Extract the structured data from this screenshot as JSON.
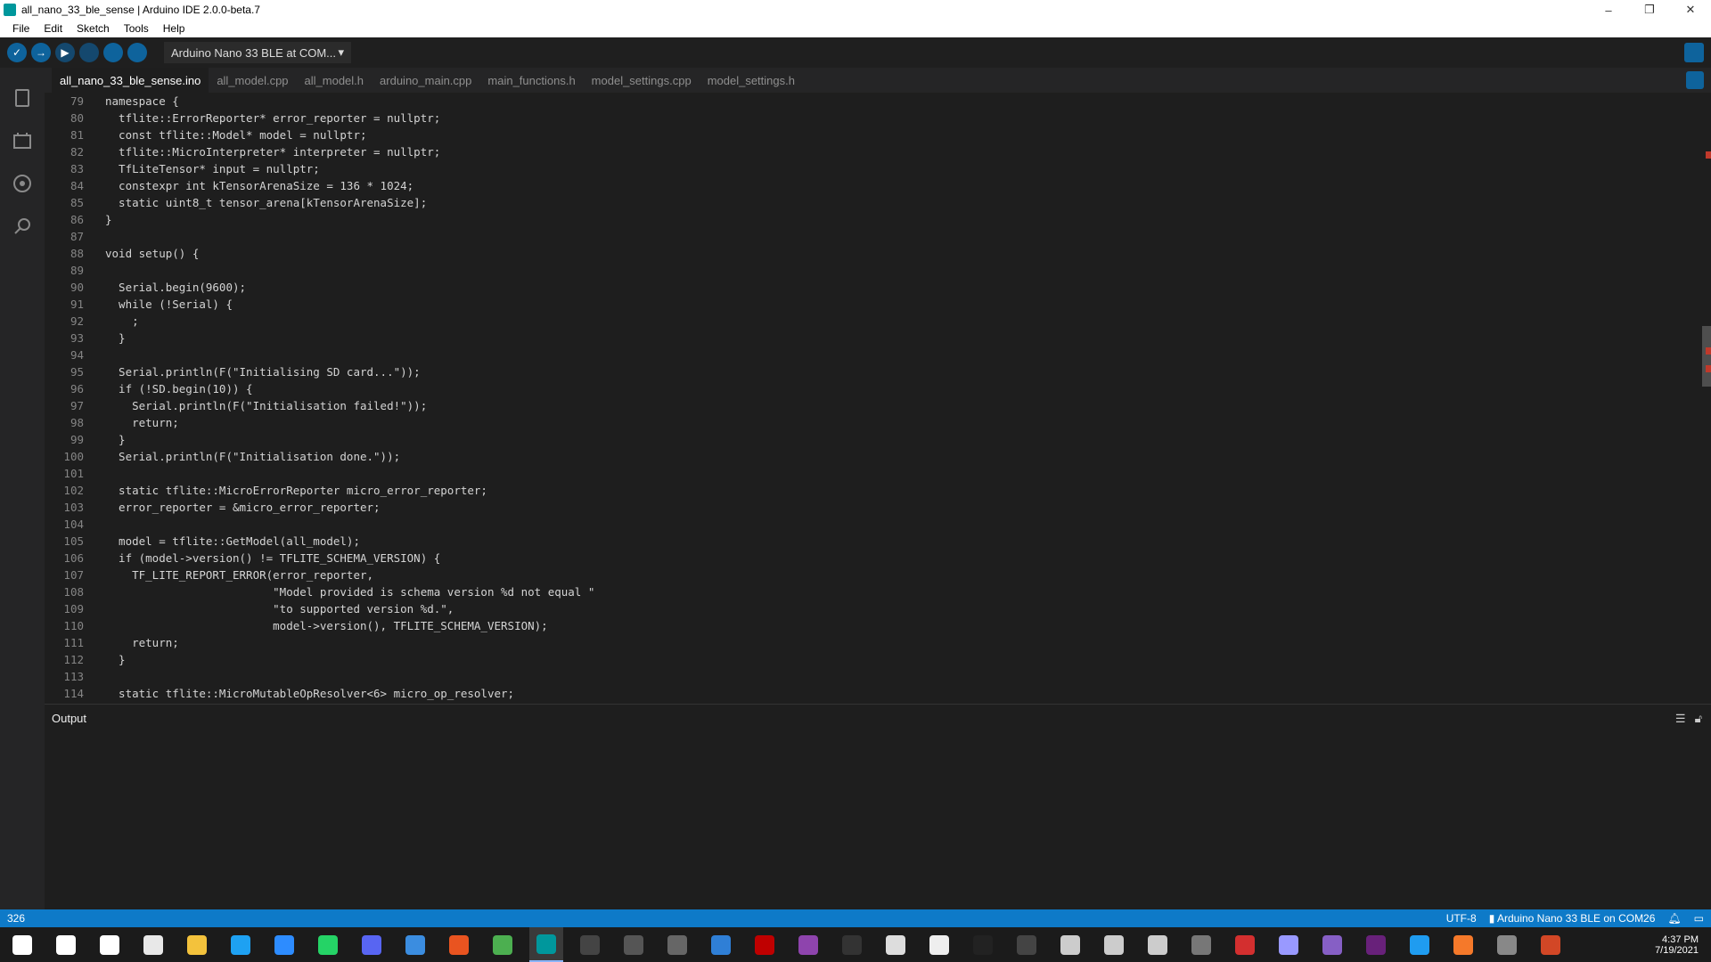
{
  "window": {
    "title": "all_nano_33_ble_sense | Arduino IDE 2.0.0-beta.7",
    "minimize": "–",
    "restore": "❐",
    "close": "✕"
  },
  "menu": [
    "File",
    "Edit",
    "Sketch",
    "Tools",
    "Help"
  ],
  "toolbar": {
    "verify": "✓",
    "upload": "→",
    "debug": "▶",
    "board": "Arduino Nano 33 BLE at COM...",
    "board_caret": "▾"
  },
  "tabs": [
    {
      "label": "all_nano_33_ble_sense.ino",
      "active": true
    },
    {
      "label": "all_model.cpp"
    },
    {
      "label": "all_model.h"
    },
    {
      "label": "arduino_main.cpp"
    },
    {
      "label": "main_functions.h"
    },
    {
      "label": "model_settings.cpp"
    },
    {
      "label": "model_settings.h"
    }
  ],
  "code_lines": [
    {
      "n": "79",
      "t": "namespace {"
    },
    {
      "n": "80",
      "t": "  tflite::ErrorReporter* error_reporter = nullptr;"
    },
    {
      "n": "81",
      "t": "  const tflite::Model* model = nullptr;"
    },
    {
      "n": "82",
      "t": "  tflite::MicroInterpreter* interpreter = nullptr;"
    },
    {
      "n": "83",
      "t": "  TfLiteTensor* input = nullptr;"
    },
    {
      "n": "84",
      "t": "  constexpr int kTensorArenaSize = 136 * 1024;"
    },
    {
      "n": "85",
      "t": "  static uint8_t tensor_arena[kTensorArenaSize];"
    },
    {
      "n": "86",
      "t": "}"
    },
    {
      "n": "87",
      "t": ""
    },
    {
      "n": "88",
      "t": "void setup() {"
    },
    {
      "n": "89",
      "t": ""
    },
    {
      "n": "90",
      "t": "  Serial.begin(9600);"
    },
    {
      "n": "91",
      "t": "  while (!Serial) {"
    },
    {
      "n": "92",
      "t": "    ;"
    },
    {
      "n": "93",
      "t": "  }"
    },
    {
      "n": "94",
      "t": ""
    },
    {
      "n": "95",
      "t": "  Serial.println(F(\"Initialising SD card...\"));"
    },
    {
      "n": "96",
      "t": "  if (!SD.begin(10)) {"
    },
    {
      "n": "97",
      "t": "    Serial.println(F(\"Initialisation failed!\"));"
    },
    {
      "n": "98",
      "t": "    return;"
    },
    {
      "n": "99",
      "t": "  }"
    },
    {
      "n": "100",
      "t": "  Serial.println(F(\"Initialisation done.\"));"
    },
    {
      "n": "101",
      "t": ""
    },
    {
      "n": "102",
      "t": "  static tflite::MicroErrorReporter micro_error_reporter;"
    },
    {
      "n": "103",
      "t": "  error_reporter = &micro_error_reporter;"
    },
    {
      "n": "104",
      "t": ""
    },
    {
      "n": "105",
      "t": "  model = tflite::GetModel(all_model);"
    },
    {
      "n": "106",
      "t": "  if (model->version() != TFLITE_SCHEMA_VERSION) {"
    },
    {
      "n": "107",
      "t": "    TF_LITE_REPORT_ERROR(error_reporter,"
    },
    {
      "n": "108",
      "t": "                         \"Model provided is schema version %d not equal \""
    },
    {
      "n": "109",
      "t": "                         \"to supported version %d.\","
    },
    {
      "n": "110",
      "t": "                         model->version(), TFLITE_SCHEMA_VERSION);"
    },
    {
      "n": "111",
      "t": "    return;"
    },
    {
      "n": "112",
      "t": "  }"
    },
    {
      "n": "113",
      "t": ""
    },
    {
      "n": "114",
      "t": "  static tflite::MicroMutableOpResolver<6> micro_op_resolver;"
    }
  ],
  "output": {
    "title": "Output"
  },
  "statusbar": {
    "line": "326",
    "encoding": "UTF-8",
    "board": "Arduino Nano 33 BLE on COM26"
  },
  "taskbar": {
    "time": "4:37 PM",
    "date": "7/19/2021",
    "icons": [
      {
        "name": "windows-start-icon",
        "color": "#ffffff"
      },
      {
        "name": "search-icon",
        "color": "#ffffff"
      },
      {
        "name": "task-view-icon",
        "color": "#ffffff"
      },
      {
        "name": "app-icon-1",
        "color": "#e8e8e8"
      },
      {
        "name": "file-explorer-icon",
        "color": "#f3c23c"
      },
      {
        "name": "skype-icon",
        "color": "#1ea1f2"
      },
      {
        "name": "zoom-icon",
        "color": "#2d8cff"
      },
      {
        "name": "whatsapp-icon",
        "color": "#25d366"
      },
      {
        "name": "discord-icon",
        "color": "#5865f2"
      },
      {
        "name": "app-icon-2",
        "color": "#3b8de0"
      },
      {
        "name": "app-icon-3",
        "color": "#e95420"
      },
      {
        "name": "chrome-icon",
        "color": "#4caf50"
      },
      {
        "name": "arduino-ide-icon",
        "color": "#00979c",
        "active": true
      },
      {
        "name": "terminal-icon",
        "color": "#444444"
      },
      {
        "name": "terminal-icon-2",
        "color": "#555555"
      },
      {
        "name": "app-icon-4",
        "color": "#666666"
      },
      {
        "name": "folder-icon",
        "color": "#2f7fd6"
      },
      {
        "name": "filezilla-icon",
        "color": "#bf0000"
      },
      {
        "name": "github-icon",
        "color": "#8e44ad"
      },
      {
        "name": "epic-games-icon",
        "color": "#333333"
      },
      {
        "name": "app-icon-5",
        "color": "#dddddd"
      },
      {
        "name": "app-icon-6",
        "color": "#eeeeee"
      },
      {
        "name": "unity-icon",
        "color": "#222222"
      },
      {
        "name": "app-icon-7",
        "color": "#444444"
      },
      {
        "name": "unreal-icon",
        "color": "#cccccc"
      },
      {
        "name": "unreal-icon-2",
        "color": "#cccccc"
      },
      {
        "name": "unreal-icon-3",
        "color": "#cccccc"
      },
      {
        "name": "app-icon-8",
        "color": "#777777"
      },
      {
        "name": "app-icon-9",
        "color": "#d32f2f"
      },
      {
        "name": "premiere-icon",
        "color": "#9999ff"
      },
      {
        "name": "visual-studio-icon",
        "color": "#865fc5"
      },
      {
        "name": "visual-studio-icon-2",
        "color": "#68217a"
      },
      {
        "name": "vscode-icon",
        "color": "#1f9cf0"
      },
      {
        "name": "blender-icon",
        "color": "#f5792a"
      },
      {
        "name": "app-icon-10",
        "color": "#888888"
      },
      {
        "name": "powerpoint-icon",
        "color": "#d24726"
      }
    ]
  }
}
